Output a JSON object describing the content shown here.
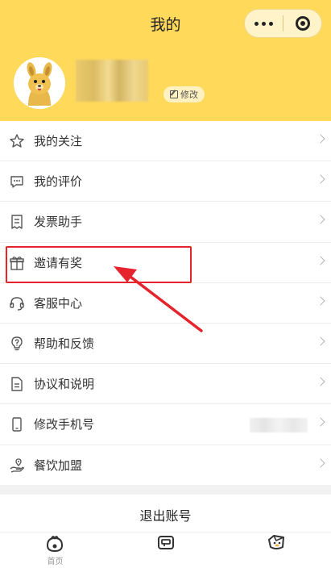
{
  "header": {
    "title": "我的"
  },
  "capsule": {
    "more_icon": "more-dots-icon",
    "close_icon": "target-icon"
  },
  "profile": {
    "edit_label": "修改"
  },
  "menu": {
    "items": [
      {
        "label": "我的关注",
        "icon": "star-icon"
      },
      {
        "label": "我的评价",
        "icon": "comment-icon"
      },
      {
        "label": "发票助手",
        "icon": "invoice-icon"
      },
      {
        "label": "邀请有奖",
        "icon": "gift-icon"
      },
      {
        "label": "客服中心",
        "icon": "headset-icon"
      },
      {
        "label": "帮助和反馈",
        "icon": "help-icon"
      },
      {
        "label": "协议和说明",
        "icon": "document-icon"
      },
      {
        "label": "修改手机号",
        "icon": "phone-icon"
      },
      {
        "label": "餐饮加盟",
        "icon": "location-hand-icon"
      }
    ]
  },
  "logout": {
    "label": "退出账号"
  },
  "tabbar": {
    "tabs": [
      {
        "label": "首页"
      },
      {
        "label": ""
      },
      {
        "label": ""
      }
    ]
  },
  "colors": {
    "accent": "#ffd95a",
    "highlight": "#e5232d"
  }
}
